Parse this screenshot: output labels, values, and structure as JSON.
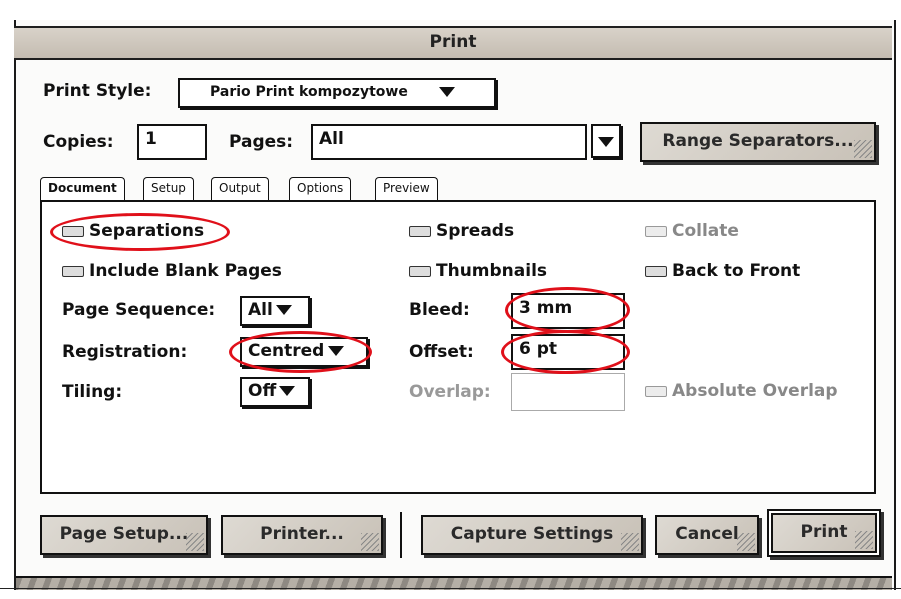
{
  "dialog": {
    "title": "Print"
  },
  "print_style": {
    "label": "Print Style:",
    "value": "Pario Print kompozytowe"
  },
  "copies": {
    "label": "Copies:",
    "value": "1"
  },
  "pages": {
    "label": "Pages:",
    "value": "All"
  },
  "range_separators_button": "Range Separators...",
  "tabs": [
    {
      "label": "Document",
      "active": true
    },
    {
      "label": "Setup"
    },
    {
      "label": "Output"
    },
    {
      "label": "Options"
    },
    {
      "label": "Preview"
    }
  ],
  "document": {
    "separations": "Separations",
    "spreads": "Spreads",
    "collate": "Collate",
    "include_blank_pages": "Include Blank Pages",
    "thumbnails": "Thumbnails",
    "back_to_front": "Back to Front",
    "page_sequence": {
      "label": "Page Sequence:",
      "value": "All"
    },
    "registration": {
      "label": "Registration:",
      "value": "Centred"
    },
    "tiling": {
      "label": "Tiling:",
      "value": "Off"
    },
    "bleed": {
      "label": "Bleed:",
      "value": "3  mm"
    },
    "offset": {
      "label": "Offset:",
      "value": "6  pt"
    },
    "overlap": {
      "label": "Overlap:",
      "value": ""
    },
    "absolute_overlap": "Absolute Overlap"
  },
  "buttons": {
    "page_setup": "Page Setup...",
    "printer": "Printer...",
    "capture_settings": "Capture Settings",
    "cancel": "Cancel",
    "print": "Print"
  },
  "colors": {
    "annotation": "#e0101a",
    "titlebar": "#cfc8be",
    "button": "#d3cdc4"
  }
}
